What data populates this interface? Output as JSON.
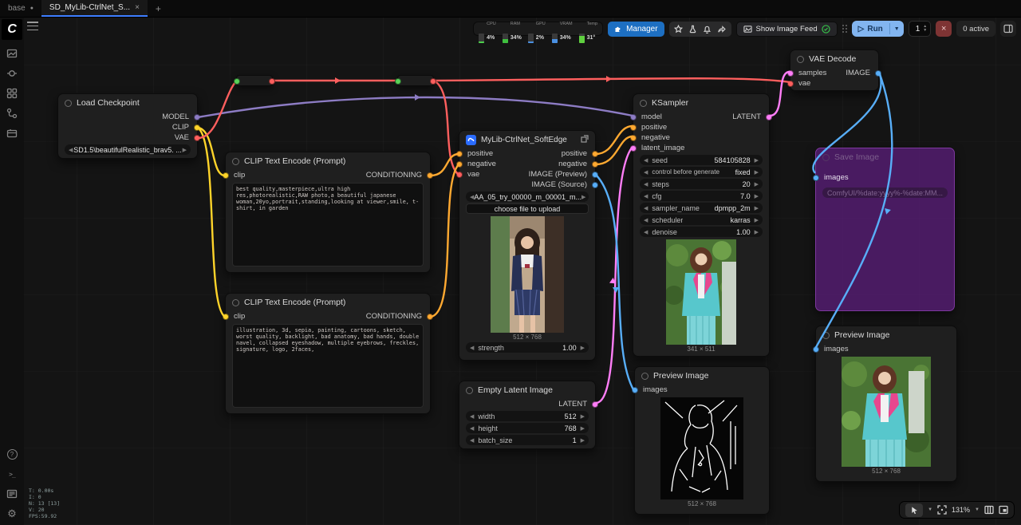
{
  "tabs": {
    "workspace": "base",
    "workflow": "SD_MyLib-CtrlNet_S...",
    "close": "×",
    "add": "+"
  },
  "topbar": {
    "stats": [
      {
        "label": "CPU",
        "value": "4%"
      },
      {
        "label": "RAM",
        "value": "34%"
      },
      {
        "label": "GPU",
        "value": "2%"
      },
      {
        "label": "VRAM",
        "value": "34%"
      },
      {
        "label": "Temp",
        "value": "31°"
      }
    ],
    "manager_label": "Manager",
    "show_image_feed_label": "Show Image Feed",
    "run_label": "Run",
    "batch_count": "1",
    "active_label": "0 active"
  },
  "colors": {
    "accent": "#3d7eff",
    "link_model": "#8d7cc4",
    "link_clip": "#ffd42a",
    "link_vae": "#ff5f5e",
    "link_conditioning": "#ffa931",
    "link_latent": "#ff7ef7",
    "link_image": "#58aef8",
    "manager_button": "#1d6fc2",
    "run_button": "#82b5f0",
    "bypass_overlay": "#7424a0",
    "reroute_input": "#59d159"
  },
  "nodes": {
    "load_checkpoint": {
      "title": "Load Checkpoint",
      "outputs": [
        "MODEL",
        "CLIP",
        "VAE"
      ],
      "ckpt_value": "SD1.5\\beautifulRealistic_brav5. ..."
    },
    "clip_encode_positive": {
      "title": "CLIP Text Encode (Prompt)",
      "input": "clip",
      "output": "CONDITIONING",
      "text": "best quality,masterpiece,ultra high res,photorealistic,RAW photo,a beautiful japanese woman,20yo,portrait,standing,looking at viewer,smile, t-shirt, in garden"
    },
    "clip_encode_negative": {
      "title": "CLIP Text Encode (Prompt)",
      "input": "clip",
      "output": "CONDITIONING",
      "text": "illustration, 3d, sepia, painting, cartoons, sketch, worst quality, backlight, bad anatomy, bad hands, double navel, collapsed eyeshadow, multiple eyebrows, freckles, signature, logo, 2faces,"
    },
    "ctrlnet": {
      "title": "MyLib-CtrlNet_SoftEdge",
      "inputs": [
        "positive",
        "negative",
        "vae"
      ],
      "outputs": [
        "positive",
        "negative",
        "IMAGE (Preview)",
        "IMAGE (Source)"
      ],
      "file_value": "AA_05_try_00000_m_00001_m...",
      "upload_label": "choose file to upload",
      "image_caption": "512 × 768",
      "strength_label": "strength",
      "strength_value": "1.00"
    },
    "empty_latent": {
      "title": "Empty Latent Image",
      "output": "LATENT",
      "widgets": [
        {
          "label": "width",
          "value": "512"
        },
        {
          "label": "height",
          "value": "768"
        },
        {
          "label": "batch_size",
          "value": "1"
        }
      ]
    },
    "ksampler": {
      "title": "KSampler",
      "inputs": [
        "model",
        "positive",
        "negative",
        "latent_image"
      ],
      "output": "LATENT",
      "widgets": [
        {
          "label": "seed",
          "value": "584105828"
        },
        {
          "label": "control before generate",
          "value": "fixed"
        },
        {
          "label": "steps",
          "value": "20"
        },
        {
          "label": "cfg",
          "value": "7.0"
        },
        {
          "label": "sampler_name",
          "value": "dpmpp_2m"
        },
        {
          "label": "scheduler",
          "value": "karras"
        },
        {
          "label": "denoise",
          "value": "1.00"
        }
      ],
      "image_caption": "341 × 511"
    },
    "vae_decode": {
      "title": "VAE Decode",
      "inputs": [
        "samples",
        "vae"
      ],
      "output": "IMAGE"
    },
    "save_image": {
      "title": "Save Image",
      "input": "images",
      "filename_value": "ComfyUI/%date:yyyy%-%date:MM..."
    },
    "preview_mid": {
      "title": "Preview Image",
      "input": "images",
      "image_caption": "512 × 768"
    },
    "preview_right": {
      "title": "Preview Image",
      "input": "images",
      "image_caption": "512 × 768"
    }
  },
  "canvas_stats": [
    "T: 0.00s",
    "I: 0",
    "N: 13 [13]",
    "V: 20",
    "FPS:59.92"
  ],
  "zoom_toolbar": {
    "zoom_level": "131%"
  }
}
